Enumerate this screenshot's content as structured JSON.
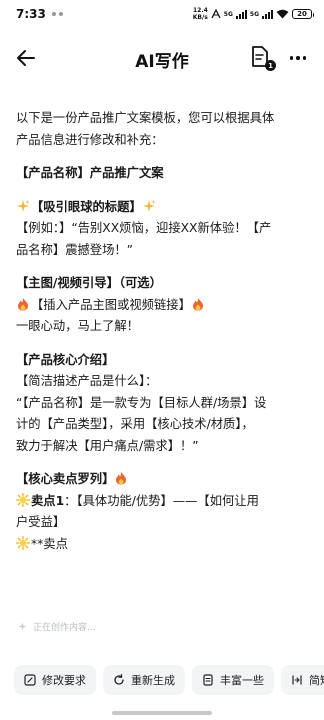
{
  "status_bar": {
    "time": "7:33",
    "net_speed_value": "12.4",
    "net_speed_unit": "KB/s",
    "signal_1": "5G",
    "signal_2": "5G",
    "battery": "20"
  },
  "header": {
    "title": "AI写作",
    "doc_badge": "1"
  },
  "content": {
    "intro_line1": "以下是一份产品推广文案模板，您可以根据具体",
    "intro_line2": "产品信息进行修改和补充：",
    "product_heading": "【产品名称】产品推广文案",
    "title_section": {
      "heading": "【吸引眼球的标题】",
      "example_line1": "【例如：】“告别XX烦恼，迎接XX新体验！【产",
      "example_line2": "品名称】震撼登场！”"
    },
    "video_section": {
      "heading": "【主图/视频引导】（可选）",
      "insert_line": "【插入产品主图或视频链接】",
      "tagline": "一眼心动，马上了解！"
    },
    "intro_section": {
      "heading": "【产品核心介绍】",
      "sub": "【简洁描述产品是什么】：",
      "desc_line1": "“【产品名称】是一款专为【目标人群/场景】设",
      "desc_line2": "计的【产品类型】，采用【核心技术/材质】，",
      "desc_line3": "致力于解决【用户痛点/需求】！”"
    },
    "selling_section": {
      "heading": "【核心卖点罗列】",
      "point1_label": "卖点1",
      "point1_line1": "：【具体功能/优势】——【如何让用",
      "point1_line2": "户受益】",
      "point2_partial": "**卖点"
    },
    "loading_text": "正在创作内容..."
  },
  "toolbar": {
    "buttons": [
      {
        "label": "修改要求",
        "icon": "edit-icon"
      },
      {
        "label": "重新生成",
        "icon": "refresh-icon"
      },
      {
        "label": "丰富一些",
        "icon": "document-icon"
      },
      {
        "label": "简短",
        "icon": "shorten-icon"
      }
    ]
  },
  "colors": {
    "accent_text": "#1a1a1a",
    "toolbar_bg": "#f3f4f6",
    "loading_text": "#b9bcc4"
  }
}
